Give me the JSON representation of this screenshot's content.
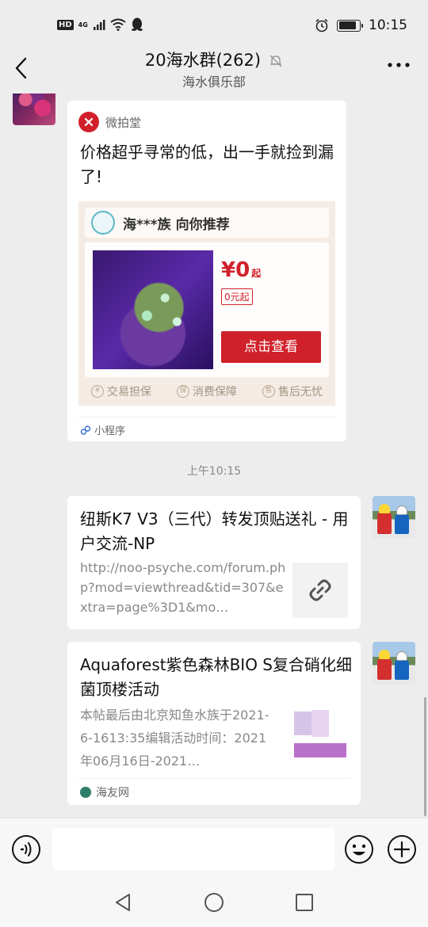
{
  "status_bar": {
    "hd_badge": "HD",
    "network": "4G",
    "time": "10:15",
    "battery_level": 0.85
  },
  "header": {
    "title": "20海水群(262)",
    "subtitle": "海水俱乐部",
    "back_icon": "chevron-left-icon",
    "mute_icon": "bell-off-icon",
    "more_icon": "more-dots-icon"
  },
  "messages": {
    "sender_stub": "…",
    "mini_program": {
      "source": "微拍堂",
      "title": "价格超乎寻常的低，出一手就捡到漏了!",
      "shop": "海***族 向你推荐",
      "price": "¥0",
      "price_suffix": "起",
      "price_tag": "0元起",
      "cta": "点击查看",
      "footer_items": [
        "交易担保",
        "消费保障",
        "售后无忧"
      ],
      "type_label": "小程序"
    },
    "timestamp": "上午10:15",
    "link_card": {
      "title": "纽斯K7 V3（三代）转发顶贴送礼 - 用户交流-NP",
      "description": "http://noo-psyche.com/forum.php?mod=viewthread&tid=307&extra=page%3D1&mo…"
    },
    "article_card": {
      "title": "Aquaforest紫色森林BIO S复合硝化细菌顶楼活动",
      "description": "本帖最后由北京知鱼水族于2021-6-1613:35编辑活动时间：2021年06月16日-2021…",
      "source": "海友网"
    }
  },
  "input_bar": {
    "voice_icon": "voice-icon",
    "emoji_icon": "emoji-icon",
    "plus_icon": "plus-circle-icon"
  },
  "system_nav": {
    "back": "triangle-back-icon",
    "home": "circle-home-icon",
    "recent": "square-recent-icon"
  }
}
